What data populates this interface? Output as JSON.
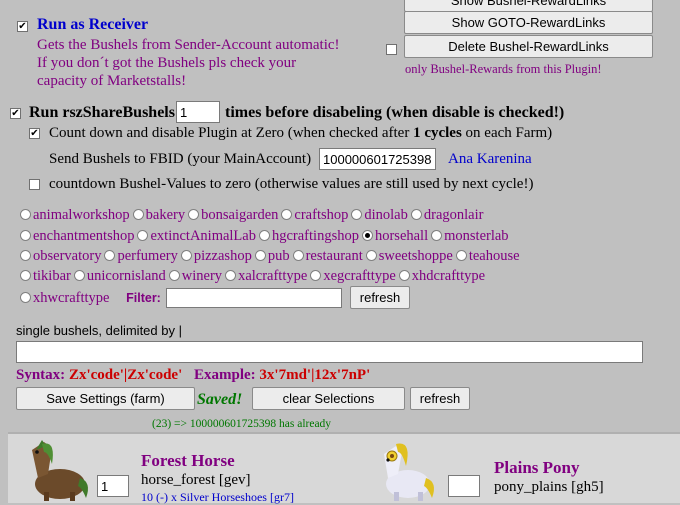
{
  "top_buttons": {
    "show_bushel": "Show Bushel-RewardLinks",
    "show_goto": "Show GOTO-RewardLinks",
    "delete_bushel": "Delete Bushel-RewardLinks",
    "only_note": "only Bushel-Rewards from this Plugin!"
  },
  "receiver": {
    "label": "Run as Receiver",
    "desc1": "Gets the Bushels from Sender-Account automatic!",
    "desc2": "If you don´t got the Bushels pls check your",
    "desc3": "capacity of Marketstalls!"
  },
  "share": {
    "label_pre": "Run rszShareBushels",
    "times_value": "1",
    "label_post": "times before disabeling (when disable is checked!)",
    "countdown_pre": "Count down and disable Plugin at Zero (when checked after",
    "countdown_num": "1 cycles",
    "countdown_post": "on each Farm)",
    "send_label": "Send Bushels to FBID (your MainAccount)",
    "fbid_value": "100000601725398",
    "fbid_name": "Ana Karenina",
    "countdown_values_label": "countdown Bushel-Values to zero (otherwise values are still used by next cycle!)"
  },
  "crafts": {
    "rows": [
      [
        {
          "label": "animalworkshop",
          "checked": false
        },
        {
          "label": "bakery",
          "checked": false
        },
        {
          "label": "bonsaigarden",
          "checked": false
        },
        {
          "label": "craftshop",
          "checked": false
        },
        {
          "label": "dinolab",
          "checked": false
        },
        {
          "label": "dragonlair",
          "checked": false
        }
      ],
      [
        {
          "label": "enchantmentshop",
          "checked": false
        },
        {
          "label": "extinctAnimalLab",
          "checked": false
        },
        {
          "label": "hgcraftingshop",
          "checked": false
        },
        {
          "label": "horsehall",
          "checked": true
        },
        {
          "label": "monsterlab",
          "checked": false
        }
      ],
      [
        {
          "label": "observatory",
          "checked": false
        },
        {
          "label": "perfumery",
          "checked": false
        },
        {
          "label": "pizzashop",
          "checked": false
        },
        {
          "label": "pub",
          "checked": false
        },
        {
          "label": "restaurant",
          "checked": false
        },
        {
          "label": "sweetshoppe",
          "checked": false
        },
        {
          "label": "teahouse",
          "checked": false
        }
      ],
      [
        {
          "label": "tikibar",
          "checked": false
        },
        {
          "label": "unicornisland",
          "checked": false
        },
        {
          "label": "winery",
          "checked": false
        },
        {
          "label": "xalcrafttype",
          "checked": false
        },
        {
          "label": "xegcrafttype",
          "checked": false
        },
        {
          "label": "xhdcrafttype",
          "checked": false
        }
      ]
    ],
    "last": {
      "label": "xhwcrafttype",
      "checked": false
    },
    "filter_label": "Filter:",
    "filter_value": "",
    "refresh": "refresh"
  },
  "bushels": {
    "label": "single bushels, delimited by |",
    "value": "",
    "syntax_label": "Syntax:",
    "syntax_value": "Zx'code'|Zx'code'",
    "example_label": "Example:",
    "example_value": "3x'7md'|12x'7nP'"
  },
  "actions": {
    "save": "Save Settings (farm)",
    "saved": "Saved!",
    "clear": "clear Selections",
    "refresh": "refresh",
    "status": "(23) => 100000601725398 has already"
  },
  "animals": [
    {
      "name": "Forest Horse",
      "code": "horse_forest [gev]",
      "qty": "1",
      "reward": "10 (-) x Silver Horseshoes [gr7]"
    },
    {
      "name": "Plains Pony",
      "code": "pony_plains [gh5]",
      "qty": ""
    }
  ],
  "colors": {
    "bg": "#c0c0c0",
    "purple": "#800080",
    "blue": "#0000cc",
    "red": "#cc0000",
    "green": "#007700"
  }
}
